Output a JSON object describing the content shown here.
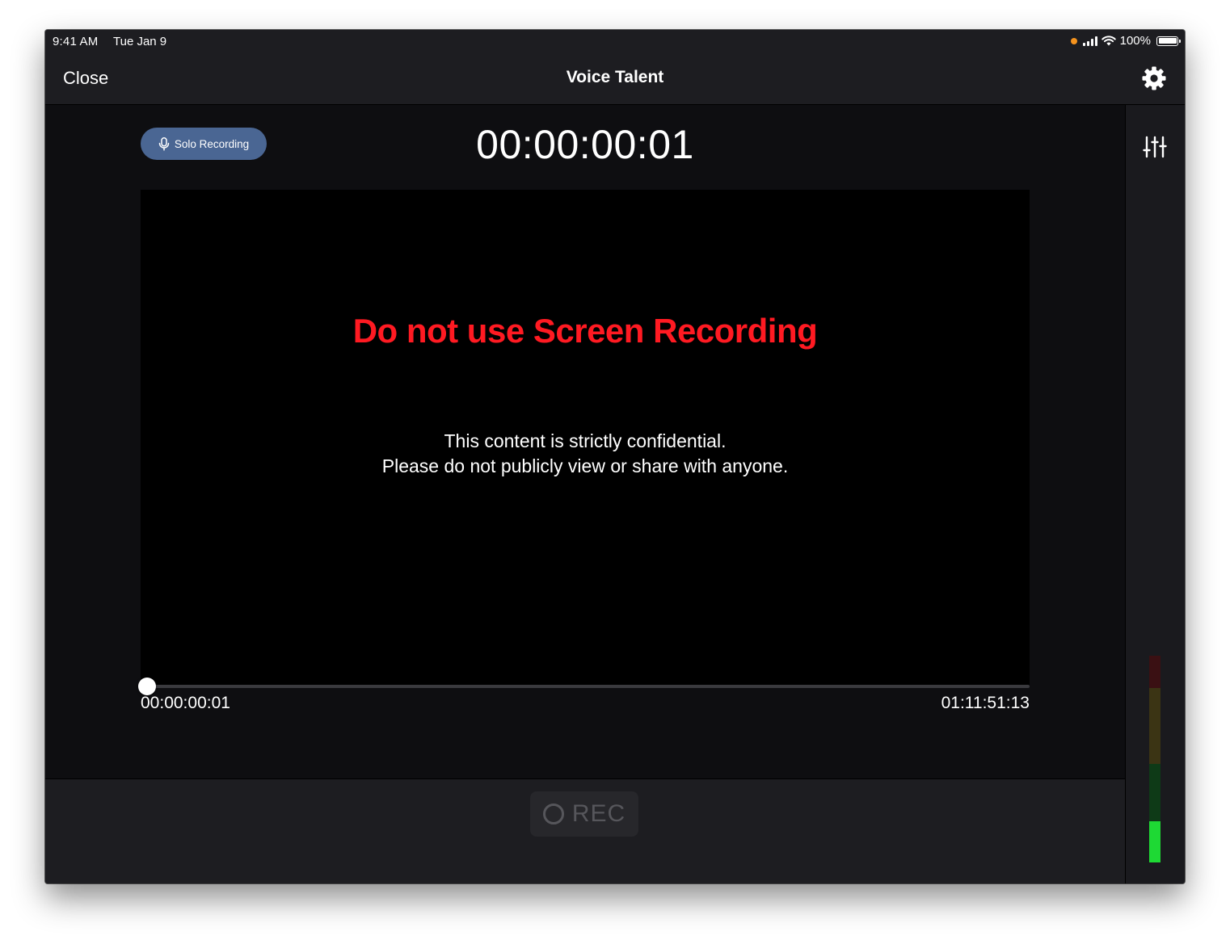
{
  "status_bar": {
    "time": "9:41 AM",
    "date": "Tue Jan 9",
    "battery_text": "100%",
    "battery_level": 1.0,
    "icons": [
      "recording-dot-icon",
      "cellular-signal-icon",
      "wifi-icon",
      "battery-icon"
    ]
  },
  "nav": {
    "close_label": "Close",
    "title": "Voice Talent",
    "settings_icon": "gear-icon"
  },
  "recording": {
    "mode_label": "Solo Recording",
    "mode_icon": "microphone-icon",
    "timecode": "00:00:00:01"
  },
  "video": {
    "warning": "Do not use Screen Recording",
    "confidential_line1": "This content is strictly confidential.",
    "confidential_line2": "Please do not publicly view or share with anyone."
  },
  "scrubber": {
    "current_time": "00:00:00:01",
    "total_time": "01:11:51:13",
    "position_fraction": 0.0
  },
  "controls": {
    "rec_label": "REC",
    "mixer_icon": "sliders-icon"
  },
  "level_meter": {
    "level_fraction": 0.2,
    "colors": {
      "active_green": "#1ed934",
      "dim_green": "#0e3a17",
      "dim_yellow": "#3b3414",
      "dim_red": "#3a1013"
    }
  },
  "colors": {
    "warning_red": "#ff1a22",
    "solo_button_blue": "#4a6693",
    "status_dot_orange": "#f5931e"
  }
}
